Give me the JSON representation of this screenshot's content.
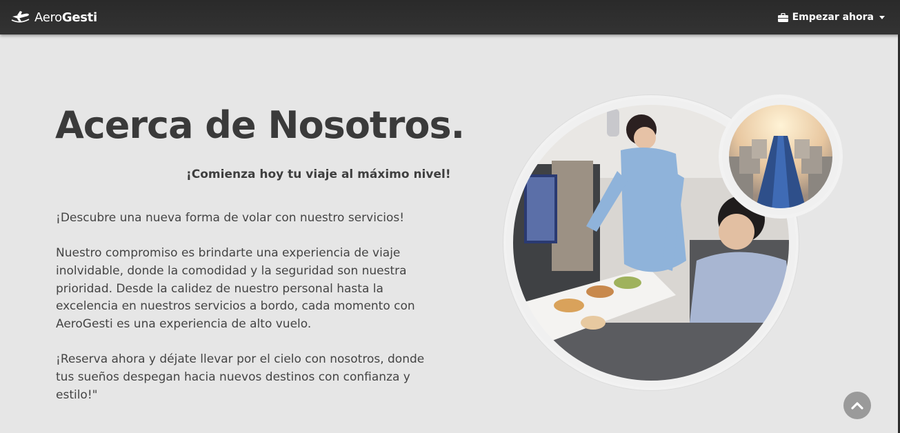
{
  "navbar": {
    "brand_part1": "Aero",
    "brand_part2": "Gesti",
    "menu_label": "Empezar ahora",
    "menu_icon": "briefcase-icon",
    "brand_icon": "airplane-logo-icon"
  },
  "about": {
    "title": "Acerca de Nosotros.",
    "tagline": "¡Comienza hoy tu viaje al máximo nivel!",
    "paragraph1": "¡Descubre una nueva forma de volar con nuestro servicios!",
    "paragraph2": "Nuestro compromiso es brindarte una experiencia de viaje inolvidable, donde la comodidad y la seguridad son nuestra prioridad. Desde la calidez de nuestro personal hasta la excelencia en nuestros servicios a bordo, cada momento con AeroGesti es una experiencia de alto vuelo.",
    "paragraph3": "¡Reserva ahora y déjate llevar por el cielo con nosotros, donde tus sueños despegan hacia nuevos destinos con confianza y estilo!\""
  },
  "images": {
    "main_photo_icon": "cabin-service-photo",
    "secondary_photo_icon": "cabin-aisle-photo"
  },
  "scroll_top_icon": "chevron-up-icon",
  "colors": {
    "navbar": "#2f2f2f",
    "page_bg": "#e6e6e6",
    "text": "#3b3b3b",
    "scroll_button": "#9a9a9a"
  }
}
